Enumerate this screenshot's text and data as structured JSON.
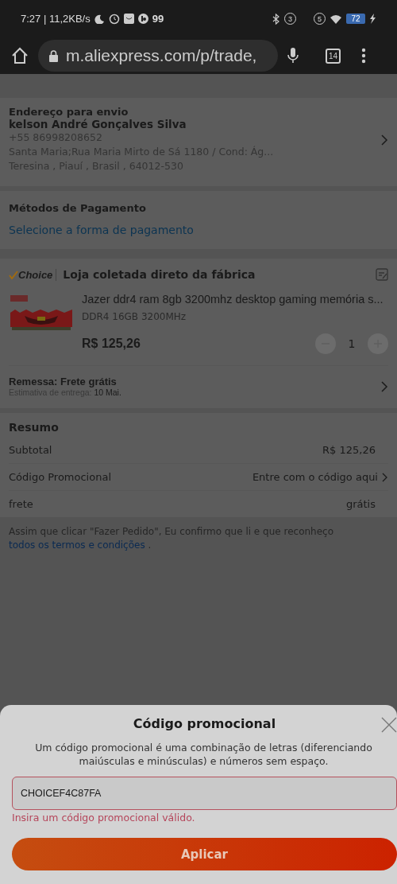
{
  "status_bar": {
    "time_speed": "7:27 | 11,2KB/s",
    "notification_count": "99",
    "badge_a": "3",
    "badge_b": "5",
    "battery": "72"
  },
  "browser": {
    "url": "m.aliexpress.com/p/trade,",
    "tab_count": "14"
  },
  "address": {
    "title": "Endereço para envio",
    "name": "kelson André Gonçalves Silva",
    "phone": "+55 86998208652",
    "street": "Santa Maria;Rua Maria Mirto de Sá 1180 / Cond: Ág...",
    "city": "Teresina , Piauí , Brasil , 64012-530"
  },
  "payment": {
    "title": "Métodos de Pagamento",
    "link": "Selecione a forma de pagamento"
  },
  "store": {
    "badge": "Choice",
    "name": "Loja coletada direto da fábrica",
    "product": {
      "kind": "picture",
      "title": "Jazer ddr4 ram 8gb 3200mhz desktop gaming memória s...",
      "variant": "DDR4 16GB 3200MHz",
      "price": "R$ 125,26",
      "quantity": "1",
      "minus_disabled": true,
      "plus_disabled": true
    },
    "shipping": "Remessa: Frete grátis",
    "delivery_label": "Estimativa de entrega:",
    "delivery_date": "10 Mai."
  },
  "summary": {
    "title": "Resumo",
    "rows": [
      {
        "kind": "value",
        "label": "Subtotal",
        "value": "R$ 125,26"
      },
      {
        "kind": "link",
        "label": "Código Promocional",
        "value": "Entre com o código aqui"
      },
      {
        "kind": "value",
        "label": "frete",
        "value": "grátis"
      }
    ]
  },
  "terms": {
    "text": "Assim que clicar \"Fazer Pedido\", Eu confirmo que li e que reconheço",
    "link": "todos os termos e condições",
    "end": " ."
  },
  "sheet": {
    "title": "Código promocional",
    "description": "Um código promocional é uma combinação de letras (diferenciando maiúsculas e minúsculas) e números sem espaço.",
    "value": "CHOICEF4C87FA",
    "invalid": true,
    "error": "Insira um código promocional válido.",
    "button": "Aplicar"
  }
}
